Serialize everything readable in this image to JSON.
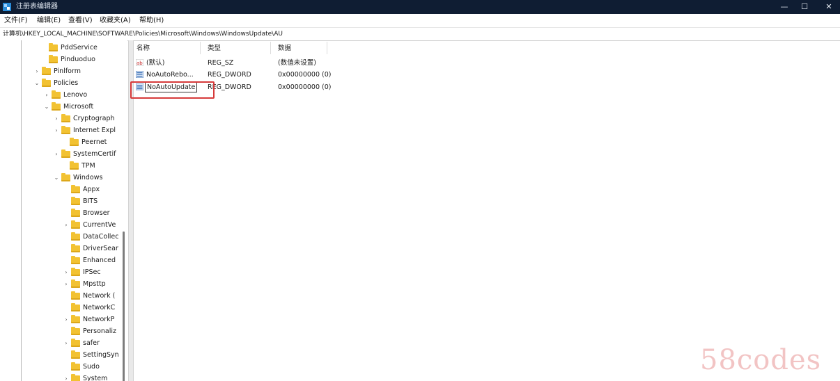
{
  "window": {
    "title": "注册表编辑器",
    "controls": {
      "minimize": "—",
      "maximize": "☐",
      "close": "✕"
    }
  },
  "menu": [
    "文件(F)",
    "编辑(E)",
    "查看(V)",
    "收藏夹(A)",
    "帮助(H)"
  ],
  "address": "计算机\\HKEY_LOCAL_MACHINE\\SOFTWARE\\Policies\\Microsoft\\Windows\\WindowsUpdate\\AU",
  "tree": [
    {
      "label": "PddService",
      "expander": ""
    },
    {
      "label": "Pinduoduo",
      "expander": ""
    },
    {
      "label": "Pinlform",
      "expander": "›"
    },
    {
      "label": "Policies",
      "expander": "⌄"
    },
    {
      "label": "Lenovo",
      "expander": "›"
    },
    {
      "label": "Microsoft",
      "expander": "⌄"
    },
    {
      "label": "Cryptograph",
      "expander": "›"
    },
    {
      "label": "Internet Expl",
      "expander": "›"
    },
    {
      "label": "Peernet",
      "expander": ""
    },
    {
      "label": "SystemCertif",
      "expander": "›"
    },
    {
      "label": "TPM",
      "expander": ""
    },
    {
      "label": "Windows",
      "expander": "⌄"
    },
    {
      "label": "Appx",
      "expander": ""
    },
    {
      "label": "BITS",
      "expander": ""
    },
    {
      "label": "Browser",
      "expander": ""
    },
    {
      "label": "CurrentVe",
      "expander": "›"
    },
    {
      "label": "DataCollec",
      "expander": ""
    },
    {
      "label": "DriverSear",
      "expander": ""
    },
    {
      "label": "Enhanced",
      "expander": ""
    },
    {
      "label": "IPSec",
      "expander": "›"
    },
    {
      "label": "Mpsttp",
      "expander": "›"
    },
    {
      "label": "Network (",
      "expander": ""
    },
    {
      "label": "NetworkC",
      "expander": ""
    },
    {
      "label": "NetworkP",
      "expander": "›"
    },
    {
      "label": "Personaliz",
      "expander": ""
    },
    {
      "label": "safer",
      "expander": "›"
    },
    {
      "label": "SettingSyn",
      "expander": ""
    },
    {
      "label": "Sudo",
      "expander": ""
    },
    {
      "label": "System",
      "expander": "›"
    }
  ],
  "columns": {
    "name": "名称",
    "type": "类型",
    "data": "数据"
  },
  "values": [
    {
      "name": "(默认)",
      "type": "REG_SZ",
      "data": "(数值未设置)",
      "icon": "string-value-icon"
    },
    {
      "name": "NoAutoRebo...",
      "type": "REG_DWORD",
      "data": "0x00000000 (0)",
      "icon": "dword-value-icon"
    },
    {
      "name": "NoAutoUpdate",
      "type": "REG_DWORD",
      "data": "0x00000000 (0)",
      "icon": "dword-value-icon"
    }
  ],
  "watermark": "58codes",
  "colors": {
    "titlebar": "#0f1d33",
    "folder": "#f2c232",
    "highlight": "#d63a3a"
  }
}
